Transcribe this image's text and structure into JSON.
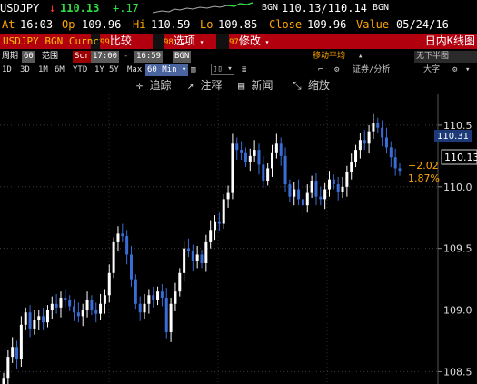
{
  "ticker_line": {
    "symbol": "USDJPY",
    "arrow": "↓",
    "last": "110.13",
    "change": "+.17",
    "source": "BGN",
    "bid_ask": "110.13/110.14",
    "source2": "BGN",
    "at_label": "At",
    "at_value": "16:03",
    "op_label": "Op",
    "op_value": "109.96",
    "hi_label": "Hi",
    "hi_value": "110.59",
    "lo_label": "Lo",
    "lo_value": "109.85",
    "close_label": "Close",
    "close_value": "109.96",
    "value_label": "Value",
    "value_date": "05/24/16"
  },
  "function_bar": {
    "security": "USDJPY BGN Curncy",
    "btn1_num": "99",
    "btn1_label": "比较",
    "btn2_num": "98",
    "btn2_label": "选项",
    "btn3_num": "97",
    "btn3_label": "修改",
    "title": "日内K线图"
  },
  "settings_bar": {
    "period_label": "周期",
    "period_value": "60",
    "range_label": "范围",
    "scr_label": "Scr",
    "start_time": "17:00",
    "end_time": "16:59",
    "source": "BGN",
    "moving_avg": "移动平均",
    "securities_analysis": "证券/分析",
    "no_half_chart": "无下半图"
  },
  "period_row": {
    "periods": [
      "1D",
      "3D",
      "1M",
      "6M",
      "YTD",
      "1Y",
      "5Y",
      "Max"
    ],
    "selected_interval": "60 Min",
    "big_label": "大字"
  },
  "toolbar": {
    "track": "追踪",
    "annotate": "注释",
    "news": "新闻",
    "zoom": "缩放"
  },
  "chart_data": {
    "type": "candlestick",
    "y_ticks": [
      "110.5",
      "110.0",
      "109.5",
      "109.0",
      "108.5"
    ],
    "ylim": [
      108.4,
      110.75
    ],
    "last_price_tag": "110.31",
    "current_price_tag": "110.13",
    "change_abs": "+2.02",
    "change_pct": "1.87%",
    "bull_color": "#ffffff",
    "bear_color": "#3a6cd6",
    "closes": [
      108.45,
      108.62,
      108.7,
      108.6,
      108.88,
      108.98,
      108.85,
      108.92,
      108.95,
      108.9,
      109.0,
      109.05,
      109.02,
      109.1,
      109.08,
      109.03,
      108.98,
      108.95,
      109.0,
      109.08,
      109.0,
      108.97,
      109.05,
      109.12,
      109.3,
      109.55,
      109.62,
      109.6,
      109.45,
      109.25,
      109.05,
      108.98,
      109.05,
      109.12,
      109.08,
      109.15,
      109.1,
      108.82,
      109.05,
      109.15,
      109.3,
      109.5,
      109.48,
      109.4,
      109.45,
      109.38,
      109.55,
      109.65,
      109.72,
      109.7,
      109.9,
      109.95,
      110.35,
      110.3,
      110.28,
      110.2,
      110.25,
      110.3,
      110.18,
      110.05,
      110.15,
      110.28,
      110.35,
      110.25,
      110.02,
      109.92,
      109.98,
      109.9,
      109.85,
      109.95,
      110.05,
      109.92,
      109.9,
      109.98,
      110.06,
      110.02,
      109.96,
      110.0,
      110.12,
      110.2,
      110.3,
      110.38,
      110.35,
      110.45,
      110.52,
      110.48,
      110.4,
      110.32,
      110.24,
      110.15,
      110.13
    ]
  }
}
